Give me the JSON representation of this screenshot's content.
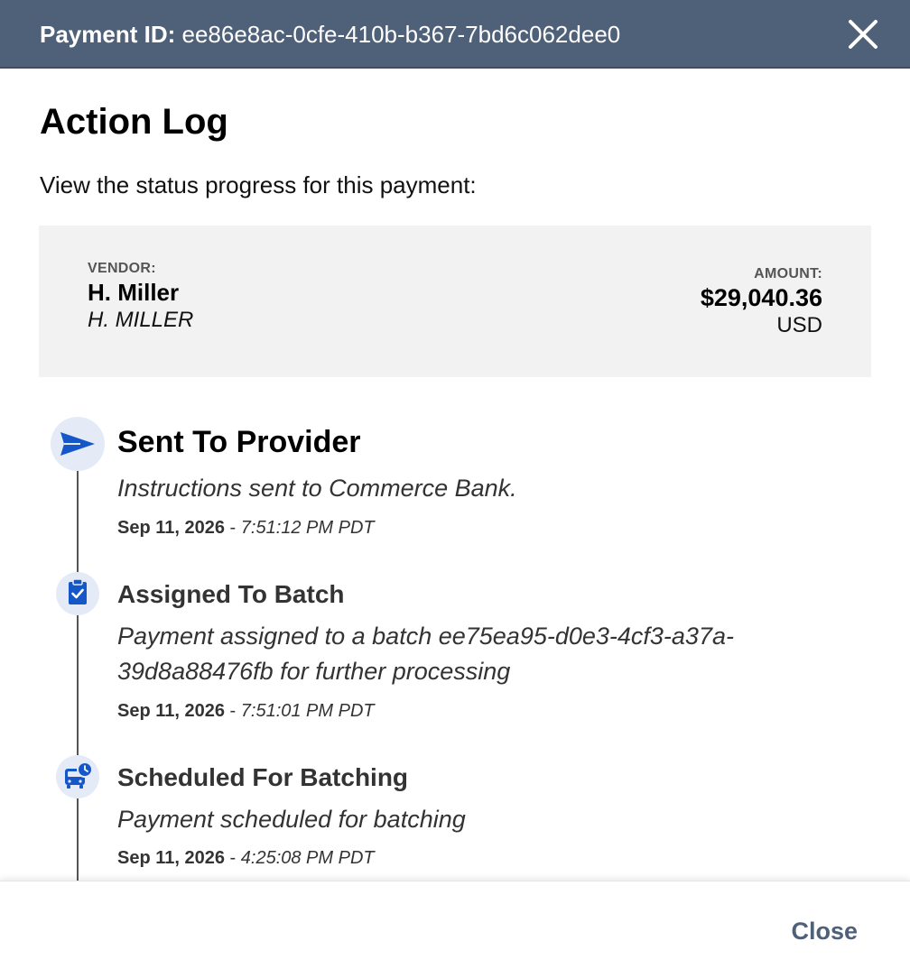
{
  "header": {
    "id_label": "Payment ID:",
    "id_value": "ee86e8ac-0cfe-410b-b367-7bd6c062dee0",
    "close_icon": "close-icon",
    "background_color": "#4f6079"
  },
  "main": {
    "title": "Action Log",
    "intro": "View the status progress for this payment:"
  },
  "summary": {
    "vendor_label": "VENDOR:",
    "vendor_name": "H. Miller",
    "vendor_alias": "H. MILLER",
    "amount_label": "AMOUNT:",
    "amount_value": "$29,040.36",
    "amount_currency": "USD"
  },
  "events": [
    {
      "icon": "paper-plane-icon",
      "title": "Sent To Provider",
      "description": "Instructions sent to Commerce Bank.",
      "date": "Sep 11, 2026",
      "separator": " - ",
      "time": "7:51:12 PM PDT"
    },
    {
      "icon": "clipboard-check-icon",
      "title": "Assigned To Batch",
      "description": "Payment assigned to a batch ee75ea95-d0e3-4cf3-a37a-39d8a88476fb for further processing",
      "date": "Sep 11, 2026",
      "separator": " - ",
      "time": "7:51:01 PM PDT"
    },
    {
      "icon": "bus-clock-icon",
      "title": "Scheduled For Batching",
      "description": "Payment scheduled for batching",
      "date": "Sep 11, 2026",
      "separator": " - ",
      "time": "4:25:08 PM PDT"
    }
  ],
  "footer": {
    "close_label": "Close"
  },
  "colors": {
    "icon_blue": "#1557c9",
    "icon_bg": "#e4ebf6",
    "summary_bg": "#f2f2f2"
  }
}
